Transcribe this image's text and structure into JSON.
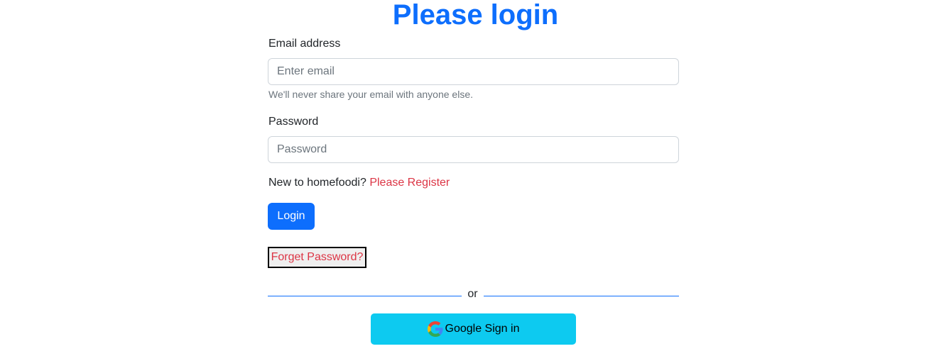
{
  "page": {
    "title": "Please login"
  },
  "form": {
    "email": {
      "label": "Email address",
      "placeholder": "Enter email",
      "value": "",
      "help": "We'll never share your email with anyone else."
    },
    "password": {
      "label": "Password",
      "placeholder": "Password",
      "value": ""
    },
    "register": {
      "prompt": "New to homefoodi? ",
      "link": "Please Register"
    },
    "login_button": "Login",
    "forget_button": "Forget Password?",
    "divider_text": "or",
    "google_button": "Google Sign in"
  },
  "colors": {
    "primary": "#0d6efd",
    "danger": "#dc3545",
    "info": "#0dcaf0",
    "muted": "#6c757d"
  },
  "icons": {
    "google": "google-icon"
  }
}
